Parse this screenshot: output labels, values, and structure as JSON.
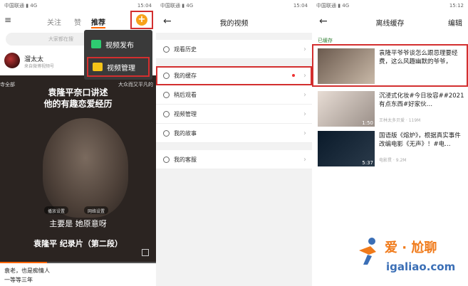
{
  "status_bar": {
    "panel1_left": "中国联通 ▮ 4G",
    "panel1_right": "15:04",
    "panel2_left": "中国联通 ▮ 4G",
    "panel2_right": "15:04",
    "panel3_left": "中国联通 ▮ 4G",
    "panel3_right": "15:12"
  },
  "panel1": {
    "tabs": [
      "关注",
      "赞",
      "推荐"
    ],
    "active_tab": "推荐",
    "search_placeholder": "大家都在搜",
    "user": {
      "name": "溜太太",
      "sub": "来自微博视频号"
    },
    "menu": [
      "视频发布",
      "视频管理"
    ],
    "video": {
      "top_left": "寺全部",
      "top_right": "大众而又平凡的",
      "title_line1": "袁隆平奈口讲述",
      "title_line2": "他的有趣恋爱经历",
      "chips": [
        "播放设置",
        "网络设置"
      ],
      "subtitle": "主要是 她原意呀",
      "caption": "袁隆平 纪录片（第二段）"
    },
    "bottom_line1": "袁老，也是痴情人",
    "bottom_line2": "一等等三年",
    "progress": 0.3
  },
  "panel2": {
    "title": "我的视频",
    "items": [
      "观看历史",
      "我的缓存",
      "稍后观看",
      "视频管理",
      "我的故事",
      "我的客服"
    ]
  },
  "panel3": {
    "title": "离线缓存",
    "edit": "编辑",
    "section_label": "已缓存",
    "videos": [
      {
        "title": "袁隆平爷爷谈怎么跟忌理要经费，这么风趣幽默的爷爷，",
        "duration": "",
        "meta": ""
      },
      {
        "title": "沉浸式化妆#今日妆容##2021有点东西#好家伙…",
        "duration": "1:50",
        "meta": "王林太多贝爱 · 119M"
      },
      {
        "title": "国语版《熔炉》，根据真实事件改编电影《无声》！#电…",
        "duration": "5:37",
        "meta": "电影贯 · 9.2M"
      }
    ]
  },
  "watermark": {
    "brand": "爱 · 尬聊",
    "url": "igaliao.com"
  }
}
